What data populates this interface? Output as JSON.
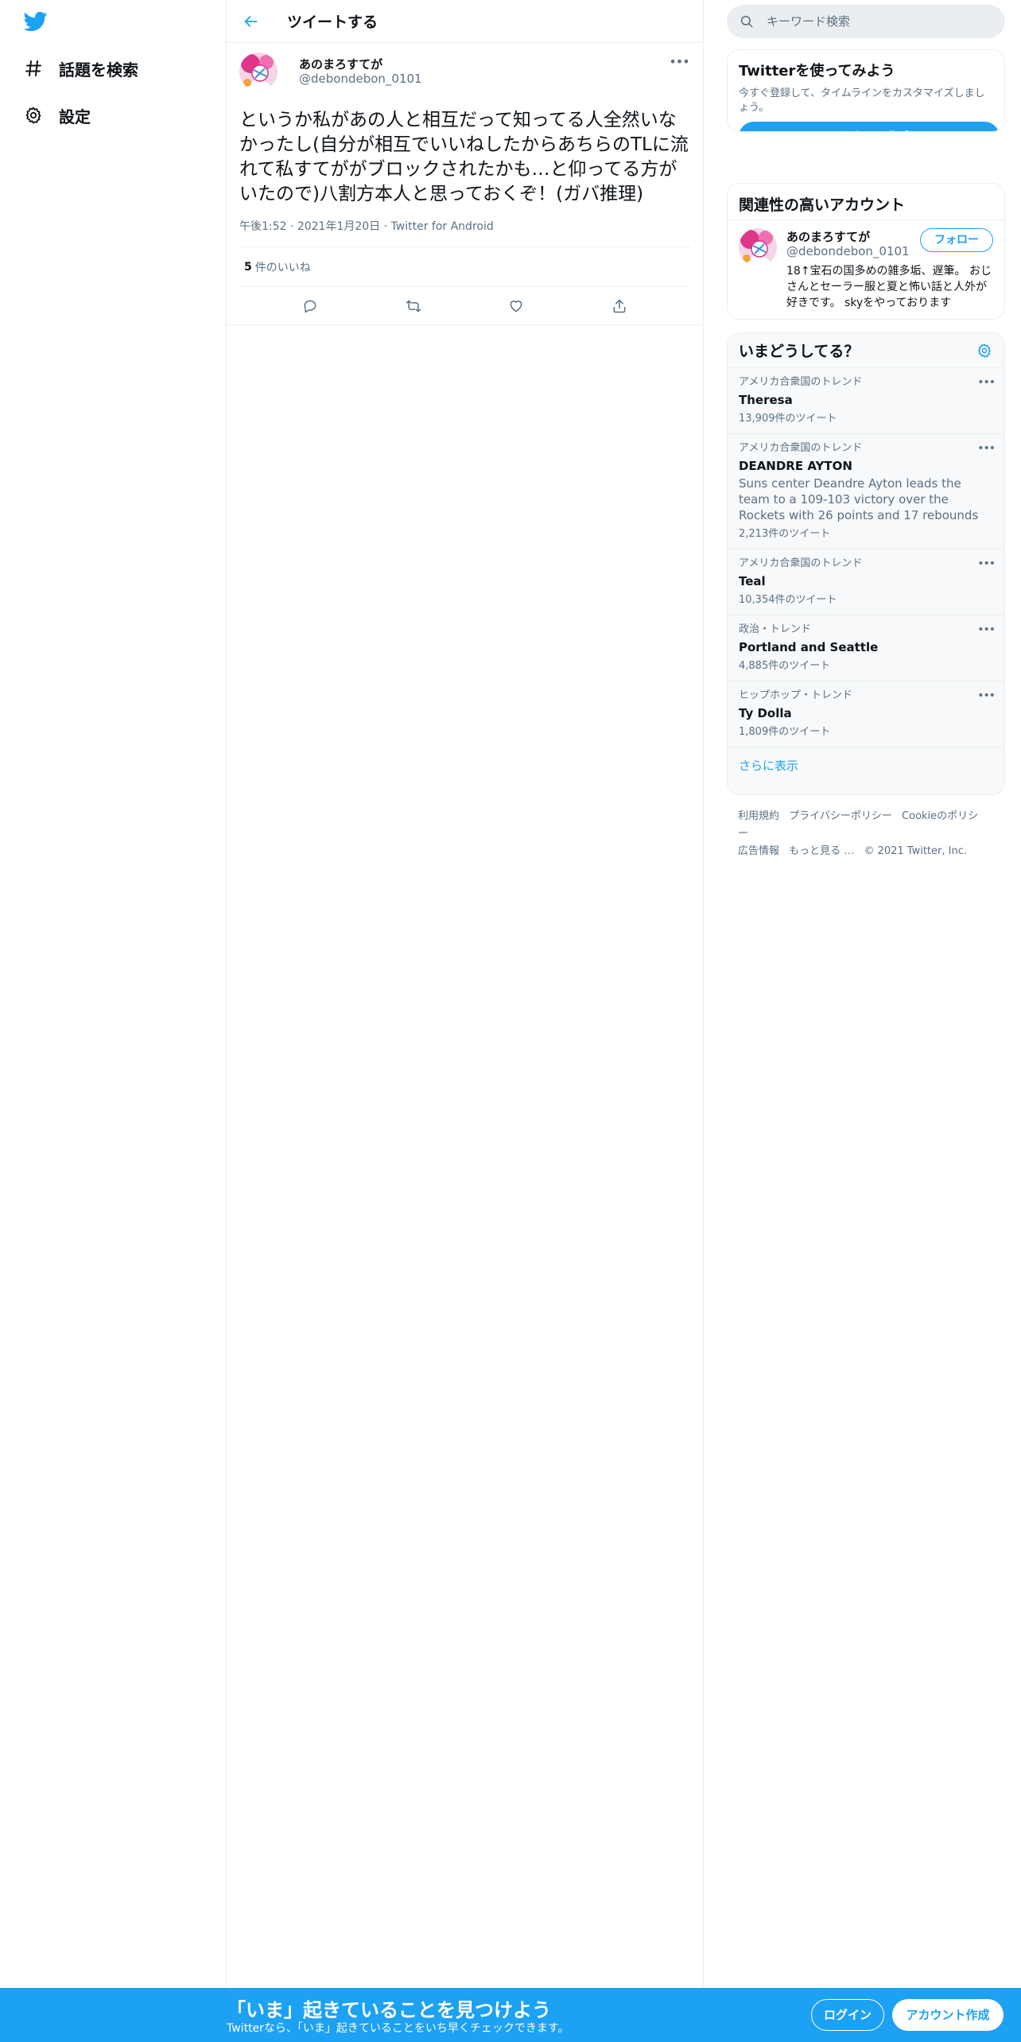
{
  "nav": {
    "items": [
      {
        "label": "話題を検索",
        "icon": "hashtag-icon"
      },
      {
        "label": "設定",
        "icon": "gear-icon"
      }
    ]
  },
  "header": {
    "title": "ツイートする"
  },
  "tweet": {
    "author_name": "あのまろすてが",
    "author_handle": "@debondebon_0101",
    "text": "というか私があの人と相互だって知ってる人全然いなかったし(自分が相互でいいねしたからあちらのTLに流れて私すてががブロックされたかも…と仰ってる方がいたので)八割方本人と思っておくぞ！(ガバ推理)",
    "time": "午後1:52",
    "date": "2021年1月20日",
    "source": "Twitter for Android",
    "likes_count": "5",
    "likes_label": "件のいいね"
  },
  "search": {
    "placeholder": "キーワード検索"
  },
  "signup_card": {
    "title": "Twitterを使ってみよう",
    "subtitle": "今すぐ登録して、タイムラインをカスタマイズしましょう。",
    "button": "アカウント作成"
  },
  "suggest_card": {
    "title": "関連性の高いアカウント",
    "name": "あのまろすてが",
    "handle": "@debondebon_0101",
    "follow": "フォロー",
    "bio": "18↑宝石の国多めの雑多垢、遅筆。 おじさんとセーラー服と夏と怖い話と人外が好きです。 skyをやっております"
  },
  "trends": {
    "title": "いまどうしてる？",
    "items": [
      {
        "meta": "アメリカ合衆国のトレンド",
        "name": "Theresa",
        "desc": "",
        "count": "13,909件のツイート"
      },
      {
        "meta": "アメリカ合衆国のトレンド",
        "name": "DEANDRE AYTON",
        "desc": "Suns center Deandre Ayton leads the team to a 109-103 victory over the Rockets with 26 points and 17 rebounds",
        "count": "2,213件のツイート"
      },
      {
        "meta": "アメリカ合衆国のトレンド",
        "name": "Teal",
        "desc": "",
        "count": "10,354件のツイート"
      },
      {
        "meta": "政治・トレンド",
        "name": "Portland and Seattle",
        "desc": "",
        "count": "4,885件のツイート"
      },
      {
        "meta": "ヒップホップ・トレンド",
        "name": "Ty Dolla",
        "desc": "",
        "count": "1,809件のツイート"
      }
    ],
    "show_more": "さらに表示"
  },
  "footer": {
    "terms": "利用規約",
    "privacy": "プライバシーポリシー",
    "cookie": "Cookieのポリシー",
    "ads": "広告情報",
    "more": "もっと見る …",
    "copyright": "© 2021 Twitter, Inc."
  },
  "bottom_bar": {
    "title": "「いま」起きていることを見つけよう",
    "subtitle": "Twitterなら、「いま」起きていることをいち早くチェックできます。",
    "login": "ログイン",
    "signup": "アカウント作成"
  },
  "colors": {
    "accent": "#1da1f2",
    "text": "#0f1419",
    "muted": "#5b7083",
    "border": "#ebeef0",
    "panel": "#f7f9fa"
  }
}
